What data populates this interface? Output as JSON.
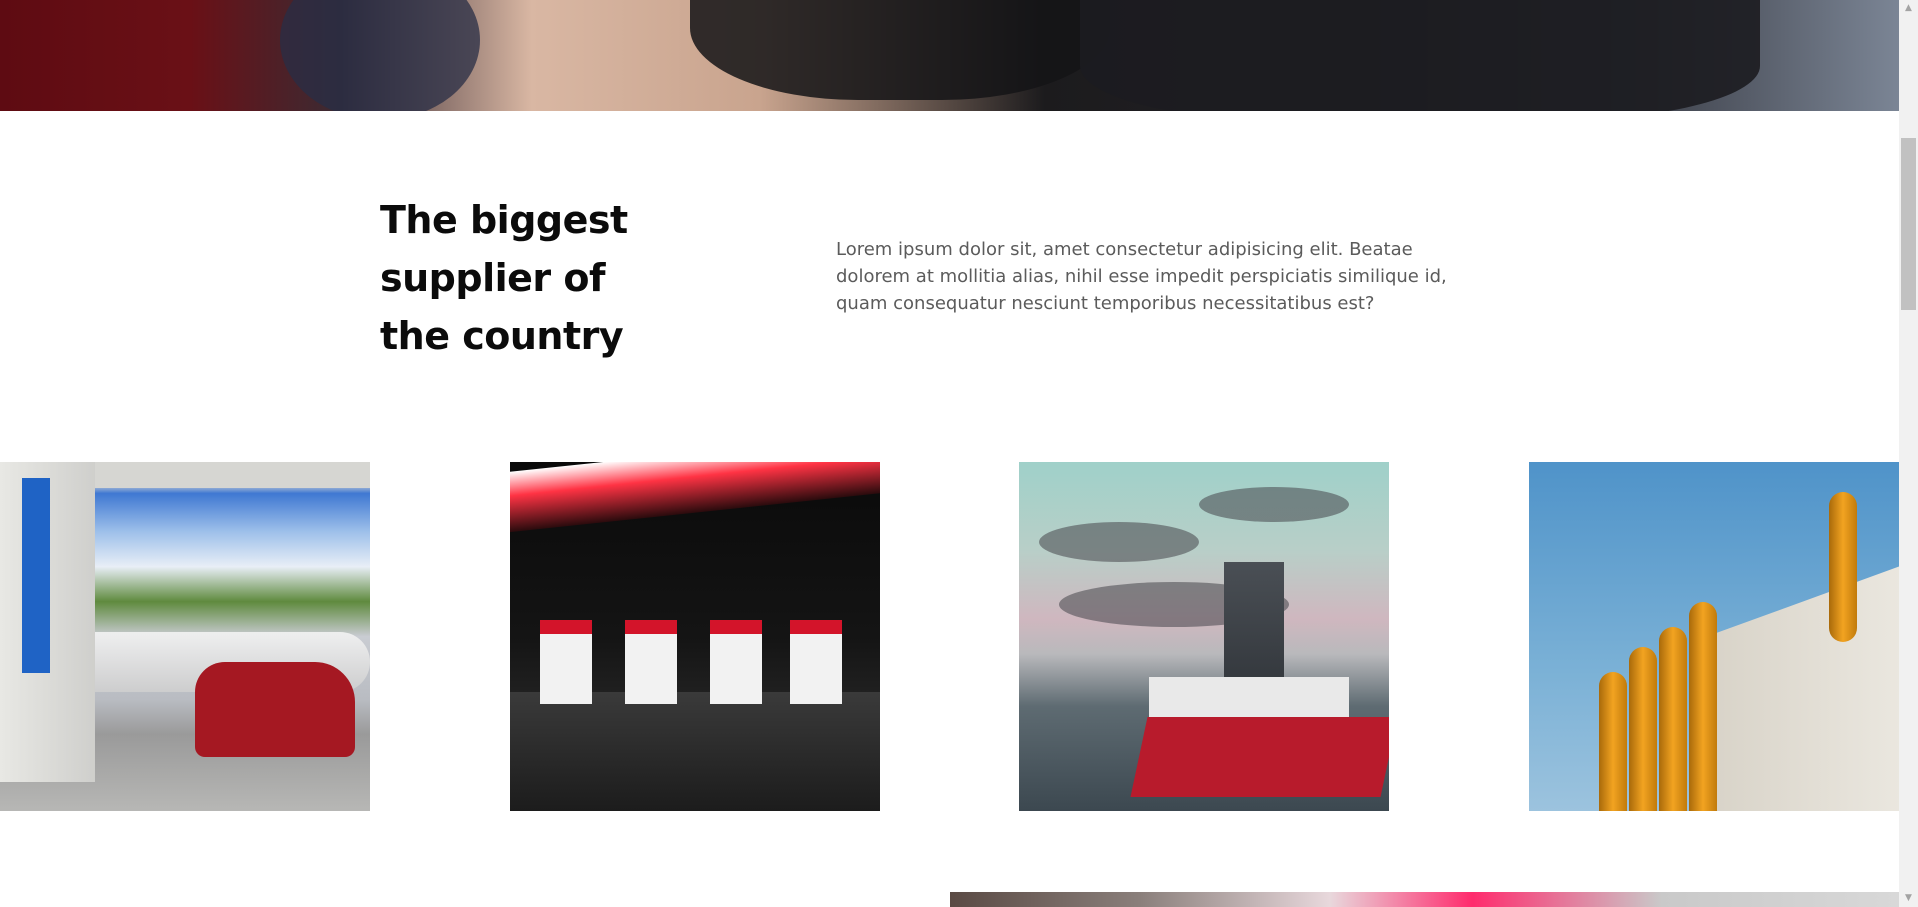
{
  "intro": {
    "heading_line1": "The biggest",
    "heading_line2": "supplier of",
    "heading_line3": "the country",
    "body": "Lorem ipsum dolor sit, amet consectetur adipisicing elit. Beatae dolorem at mollitia alias, nihil esse impedit perspiciatis similique id, quam consequatur nesciunt temporibus necessitatibus est?"
  },
  "gallery": {
    "images": [
      "gas-station-day",
      "gas-station-night",
      "offshore-ship",
      "industrial-pipes"
    ]
  },
  "scrollbar": {
    "up_glyph": "▲",
    "down_glyph": "▼"
  }
}
